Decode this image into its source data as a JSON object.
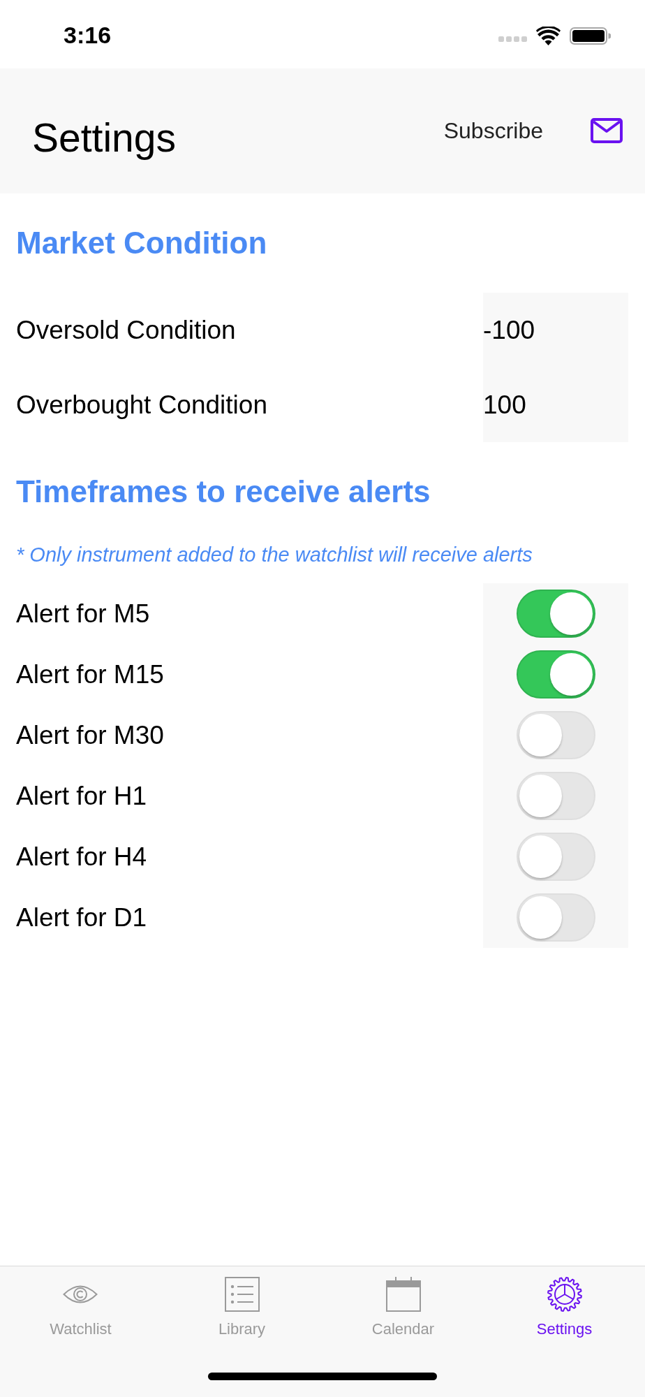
{
  "status_bar": {
    "time": "3:16"
  },
  "nav_bar": {
    "title": "Settings",
    "action": "Subscribe"
  },
  "sections": [
    {
      "title": "Market Condition",
      "rows": [
        {
          "kind": "value",
          "label": "Oversold Condition",
          "value": "-100"
        },
        {
          "kind": "value",
          "label": "Overbought Condition",
          "value": "100"
        }
      ]
    },
    {
      "title": "Timeframes to receive alerts",
      "note": "* Only instrument added to the watchlist will receive alerts",
      "rows": [
        {
          "kind": "toggle",
          "label": "Alert for M5",
          "on": true
        },
        {
          "kind": "toggle",
          "label": "Alert for M15",
          "on": true
        },
        {
          "kind": "toggle",
          "label": "Alert for M30",
          "on": false
        },
        {
          "kind": "toggle",
          "label": "Alert for H1",
          "on": false
        },
        {
          "kind": "toggle",
          "label": "Alert for H4",
          "on": false
        },
        {
          "kind": "toggle",
          "label": "Alert for D1",
          "on": false
        }
      ]
    }
  ],
  "tab_bar": {
    "tabs": [
      {
        "label": "Watchlist",
        "selected": false
      },
      {
        "label": "Library",
        "selected": false
      },
      {
        "label": "Calendar",
        "selected": false
      },
      {
        "label": "Settings",
        "selected": true
      }
    ]
  }
}
